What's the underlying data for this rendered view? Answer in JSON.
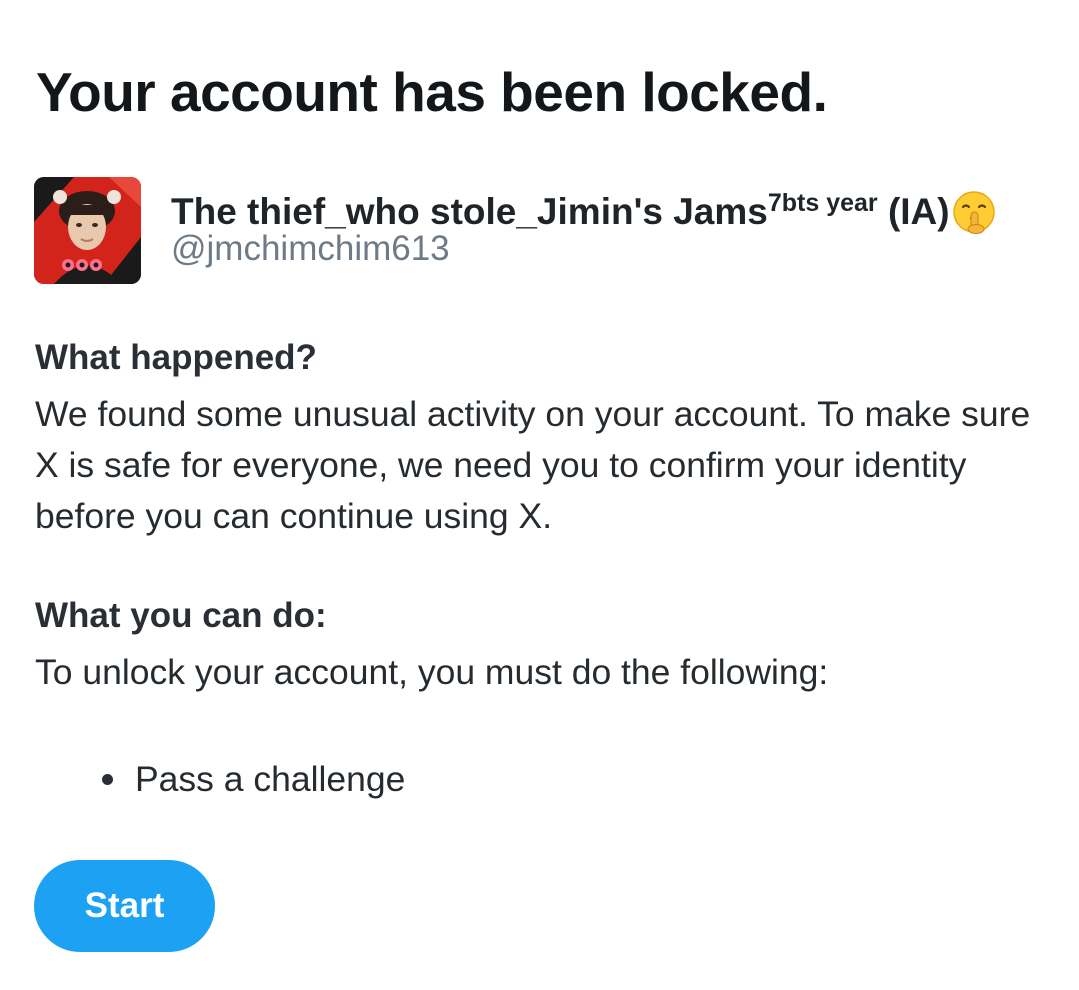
{
  "page": {
    "title": "Your account has been locked."
  },
  "account": {
    "display_name": "The thief_who stole_Jimin's Jams",
    "display_name_sup": "7bts year",
    "display_name_suffix": " (IA)",
    "emoji": "shushing-face-icon",
    "handle": "@jmchimchim613"
  },
  "what_happened": {
    "heading": "What happened?",
    "text": "We found some unusual activity on your account. To make sure X is safe for everyone, we need you to confirm your identity before you can continue using X."
  },
  "what_you_can_do": {
    "heading": "What you can do:",
    "text": "To unlock your account, you must do the following:",
    "steps": [
      {
        "label": "Pass a challenge"
      }
    ]
  },
  "actions": {
    "start_label": "Start"
  },
  "colors": {
    "accent": "#1da1f2",
    "title_text": "#14171a",
    "handle_text": "#6e7a86",
    "avatar_background": "#d3241c"
  }
}
